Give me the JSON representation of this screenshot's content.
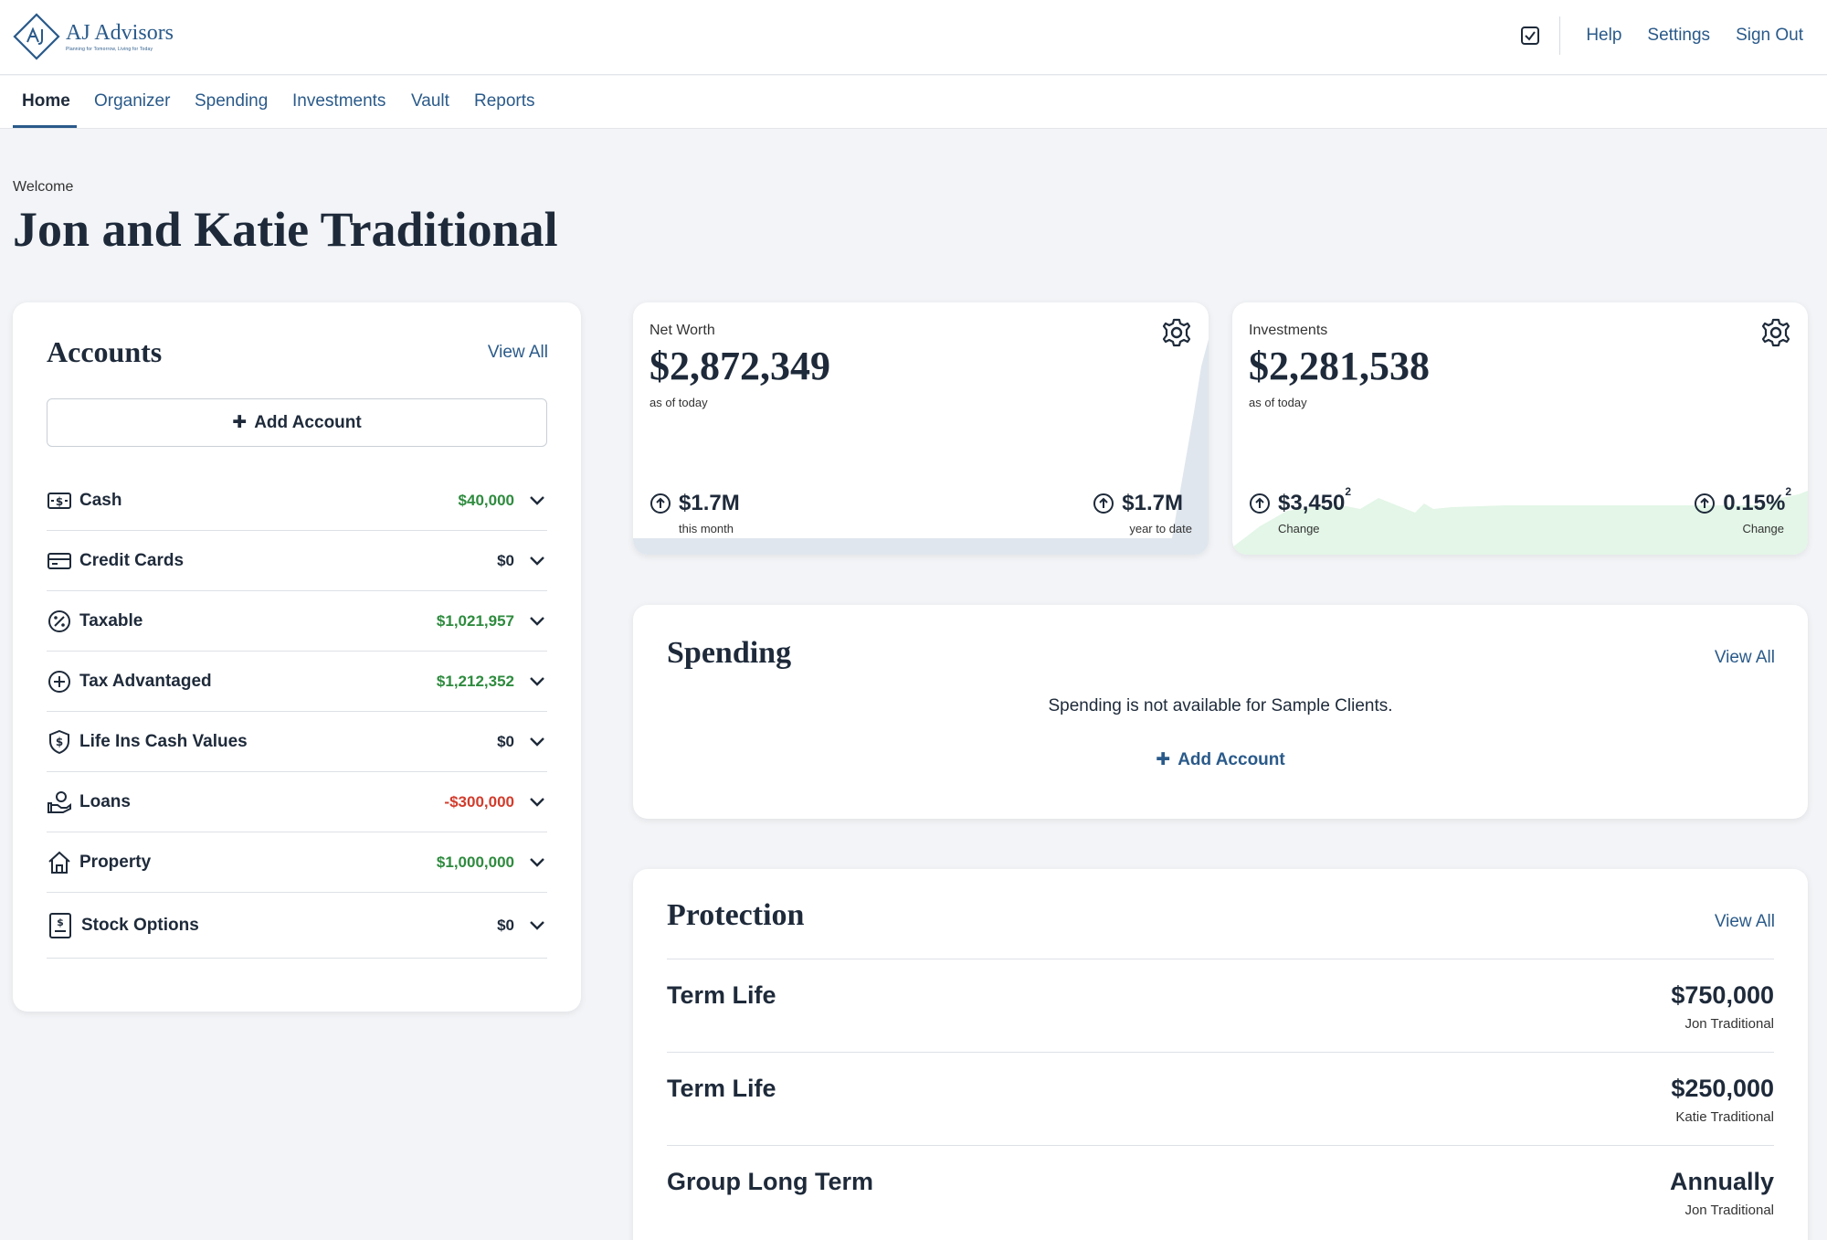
{
  "brand": {
    "name": "AJ Advisors",
    "tagline": "Planning for Tomorrow, Living for Today"
  },
  "header": {
    "links": [
      "Help",
      "Settings",
      "Sign Out"
    ]
  },
  "nav": {
    "tabs": [
      "Home",
      "Organizer",
      "Spending",
      "Investments",
      "Vault",
      "Reports"
    ],
    "active": "Home"
  },
  "welcome": {
    "label": "Welcome",
    "name": "Jon and Katie Traditional"
  },
  "accounts": {
    "title": "Accounts",
    "view_all": "View All",
    "add_label": "Add Account",
    "items": [
      {
        "label": "Cash",
        "value": "$40,000",
        "tone": "pos",
        "icon": "cash-icon"
      },
      {
        "label": "Credit Cards",
        "value": "$0",
        "tone": "zero",
        "icon": "credit-card-icon"
      },
      {
        "label": "Taxable",
        "value": "$1,021,957",
        "tone": "pos",
        "icon": "percent-icon"
      },
      {
        "label": "Tax Advantaged",
        "value": "$1,212,352",
        "tone": "pos",
        "icon": "plus-circle-icon"
      },
      {
        "label": "Life Ins Cash Values",
        "value": "$0",
        "tone": "zero",
        "icon": "shield-dollar-icon"
      },
      {
        "label": "Loans",
        "value": "-$300,000",
        "tone": "neg",
        "icon": "loan-hand-icon"
      },
      {
        "label": "Property",
        "value": "$1,000,000",
        "tone": "pos",
        "icon": "house-icon"
      },
      {
        "label": "Stock Options",
        "value": "$0",
        "tone": "zero",
        "icon": "stock-certificate-icon"
      }
    ]
  },
  "net_worth": {
    "label": "Net Worth",
    "value": "$2,872,349",
    "sub": "as of today",
    "stat_left": {
      "value": "$1.7M",
      "label": "this month"
    },
    "stat_right": {
      "value": "$1.7M",
      "label": "year to date"
    },
    "chart_color": "#dfe6ee"
  },
  "investments": {
    "label": "Investments",
    "value": "$2,281,538",
    "sub": "as of today",
    "stat_left": {
      "value": "$3,450",
      "sup": "2",
      "label": "Change"
    },
    "stat_right": {
      "value": "0.15%",
      "sup": "2",
      "label": "Change"
    },
    "chart_color": "#e3f6e7"
  },
  "spending": {
    "title": "Spending",
    "view_all": "View All",
    "message": "Spending is not available for Sample Clients.",
    "add_label": "Add Account"
  },
  "protection": {
    "title": "Protection",
    "view_all": "View All",
    "items": [
      {
        "name": "Term Life",
        "amount": "$750,000",
        "owner": "Jon Traditional"
      },
      {
        "name": "Term Life",
        "amount": "$250,000",
        "owner": "Katie Traditional"
      },
      {
        "name": "Group Long Term",
        "amount": "Annually",
        "owner": "Jon Traditional"
      }
    ]
  },
  "colors": {
    "accent": "#2a5a8a",
    "positive": "#2e8b3e",
    "negative": "#d23c2c",
    "text": "#1e2a3a"
  }
}
